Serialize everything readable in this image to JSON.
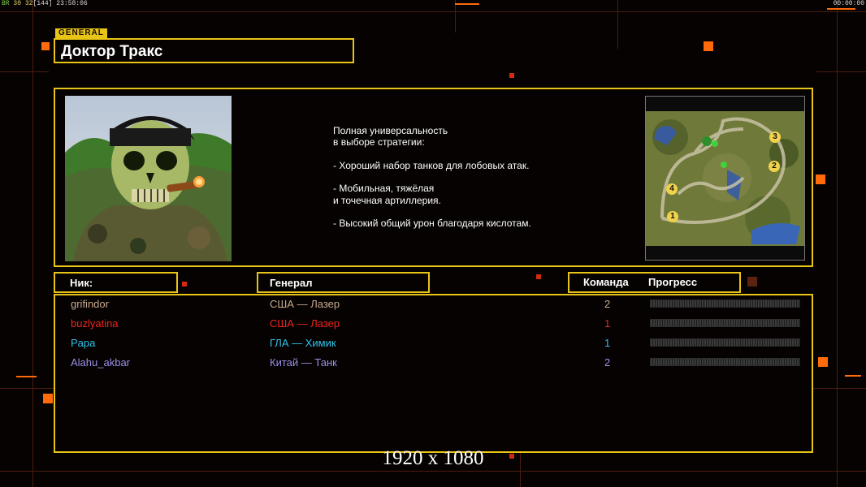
{
  "hud": {
    "left": {
      "a": "BR",
      "b": "30",
      "c": "32",
      "d": "[144]",
      "e": "23:58:06"
    },
    "right": "00:00:00"
  },
  "general_tag": "GENERAL",
  "general_name": "Доктор Тракс",
  "description": "Полная универсальность\nв выборе стратегии:\n\n- Хороший набор танков для лобовых атак.\n\n- Мобильная, тяжёлая\nи точечная артиллерия.\n\n- Высокий общий урон благодаря кислотам.",
  "headers": {
    "nick": "Ник:",
    "general": "Генерал",
    "team": "Команда",
    "progress": "Прогресс"
  },
  "players": [
    {
      "nick": "grifindor",
      "general": "США — Лазер",
      "team": "2",
      "progress": 0,
      "color": "#c8aa8e"
    },
    {
      "nick": "buzlyatina",
      "general": "США — Лазер",
      "team": "1",
      "progress": 0,
      "color": "#f0241e"
    },
    {
      "nick": "Papa",
      "general": "ГЛА — Химик",
      "team": "1",
      "progress": 0,
      "color": "#31c2e8"
    },
    {
      "nick": "Alahu_akbar",
      "general": "Китай — Танк",
      "team": "2",
      "progress": 0,
      "color": "#9e8fe8"
    }
  ],
  "map_start_positions": [
    "1",
    "2",
    "3",
    "4"
  ],
  "resolution": "1920 x 1080",
  "colors": {
    "frame": "#e8c417",
    "accent": "#ff6a0a"
  }
}
